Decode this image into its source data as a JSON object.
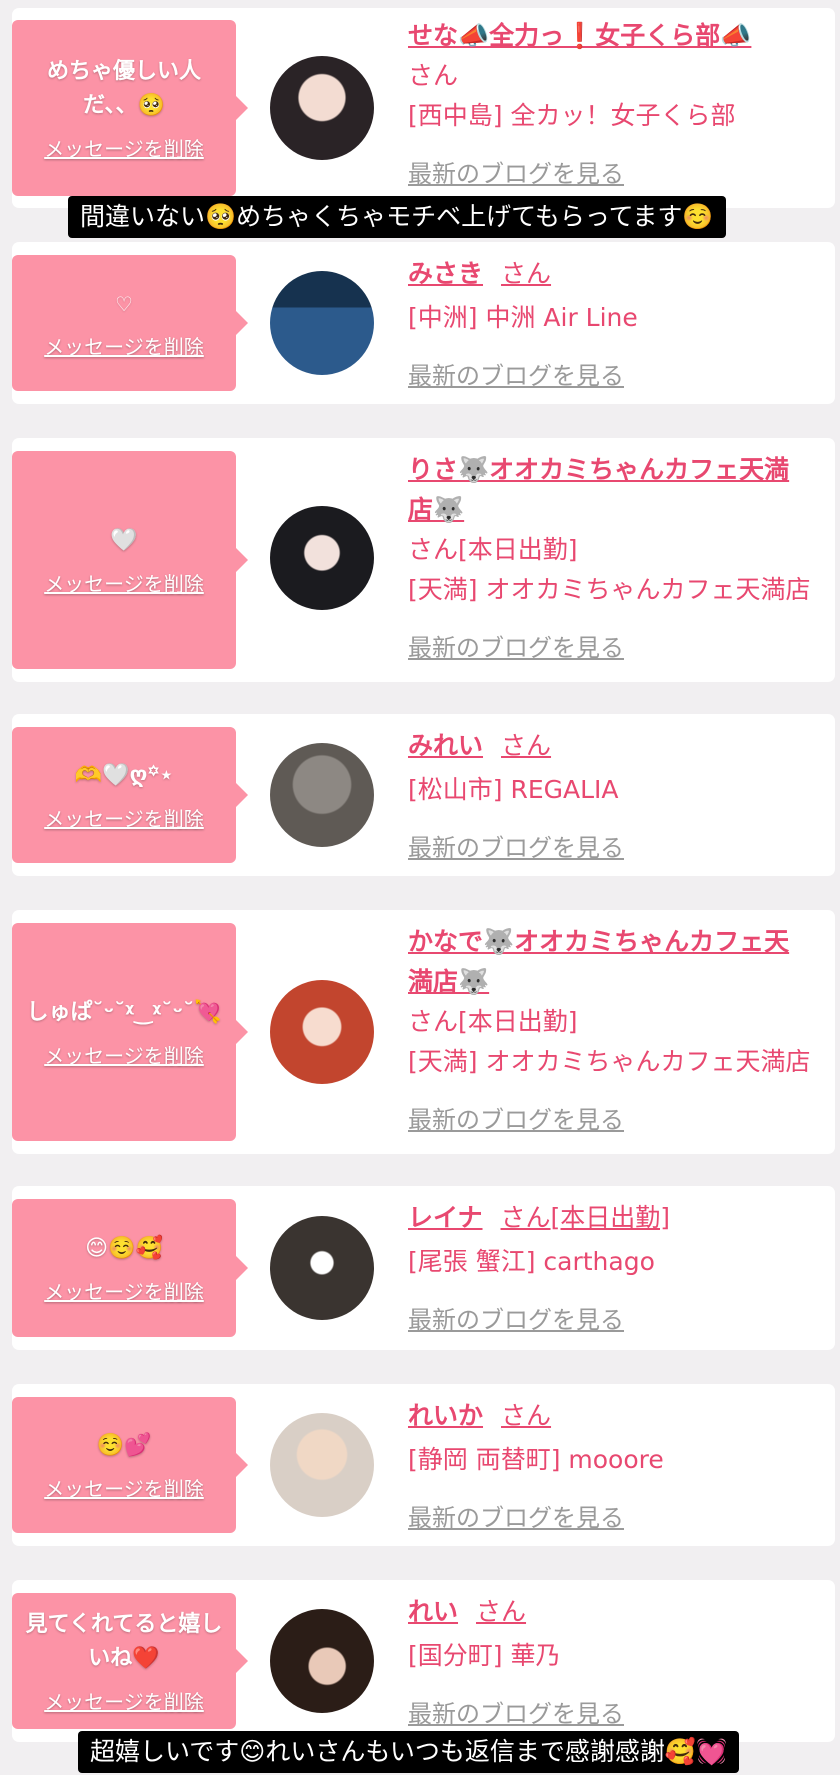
{
  "delete_label": "メッセージを削除",
  "blog_label": "最新のブログを見る",
  "san_label": "さん",
  "items": [
    {
      "message": "めちゃ優しい人だ、、🥺",
      "name": "せな📣全力っ❗️女子くら部📣",
      "status": "",
      "shop": "[西中島] 全カッ！女子くら部"
    },
    {
      "message": "♡",
      "name": "みさき",
      "status": "",
      "shop": "[中洲] 中洲 Air Line"
    },
    {
      "message": "🤍",
      "name": "りさ🐺オオカミちゃんカフェ天満店🐺",
      "status": "[本日出勤]",
      "shop": "[天満] オオカミちゃんカフェ天満店"
    },
    {
      "message": "🫶🤍ღ︎꙳⋆",
      "name": "みれい",
      "status": "",
      "shop": "[松山市] REGALIA"
    },
    {
      "message": "しゅぱ˘ᵕ˘ᵡ‿ᵡ˘ᵕ˘💘",
      "name": "かなで🐺オオカミちゃんカフェ天満店🐺",
      "status": "[本日出勤]",
      "shop": "[天満] オオカミちゃんカフェ天満店"
    },
    {
      "message": "😊☺️🥰",
      "name": "レイナ",
      "status": "[本日出勤]",
      "shop": "[尾張 蟹江] carthago"
    },
    {
      "message": "☺️💕",
      "name": "れいか",
      "status": "",
      "shop": "[静岡 両替町] mooore"
    },
    {
      "message": "見てくれてると嬉しいね❤️",
      "name": "れい",
      "status": "",
      "shop": "[国分町] 華乃"
    }
  ],
  "captions": [
    "間違いない🥺めちゃくちゃモチベ上げてもらってます☺️",
    "超嬉しいです😊れいさんもいつも返信まで感謝感謝🥰💓"
  ],
  "colors": {
    "accent": "#e84870",
    "bubble": "#fc93a6",
    "background": "#f1eff1"
  }
}
